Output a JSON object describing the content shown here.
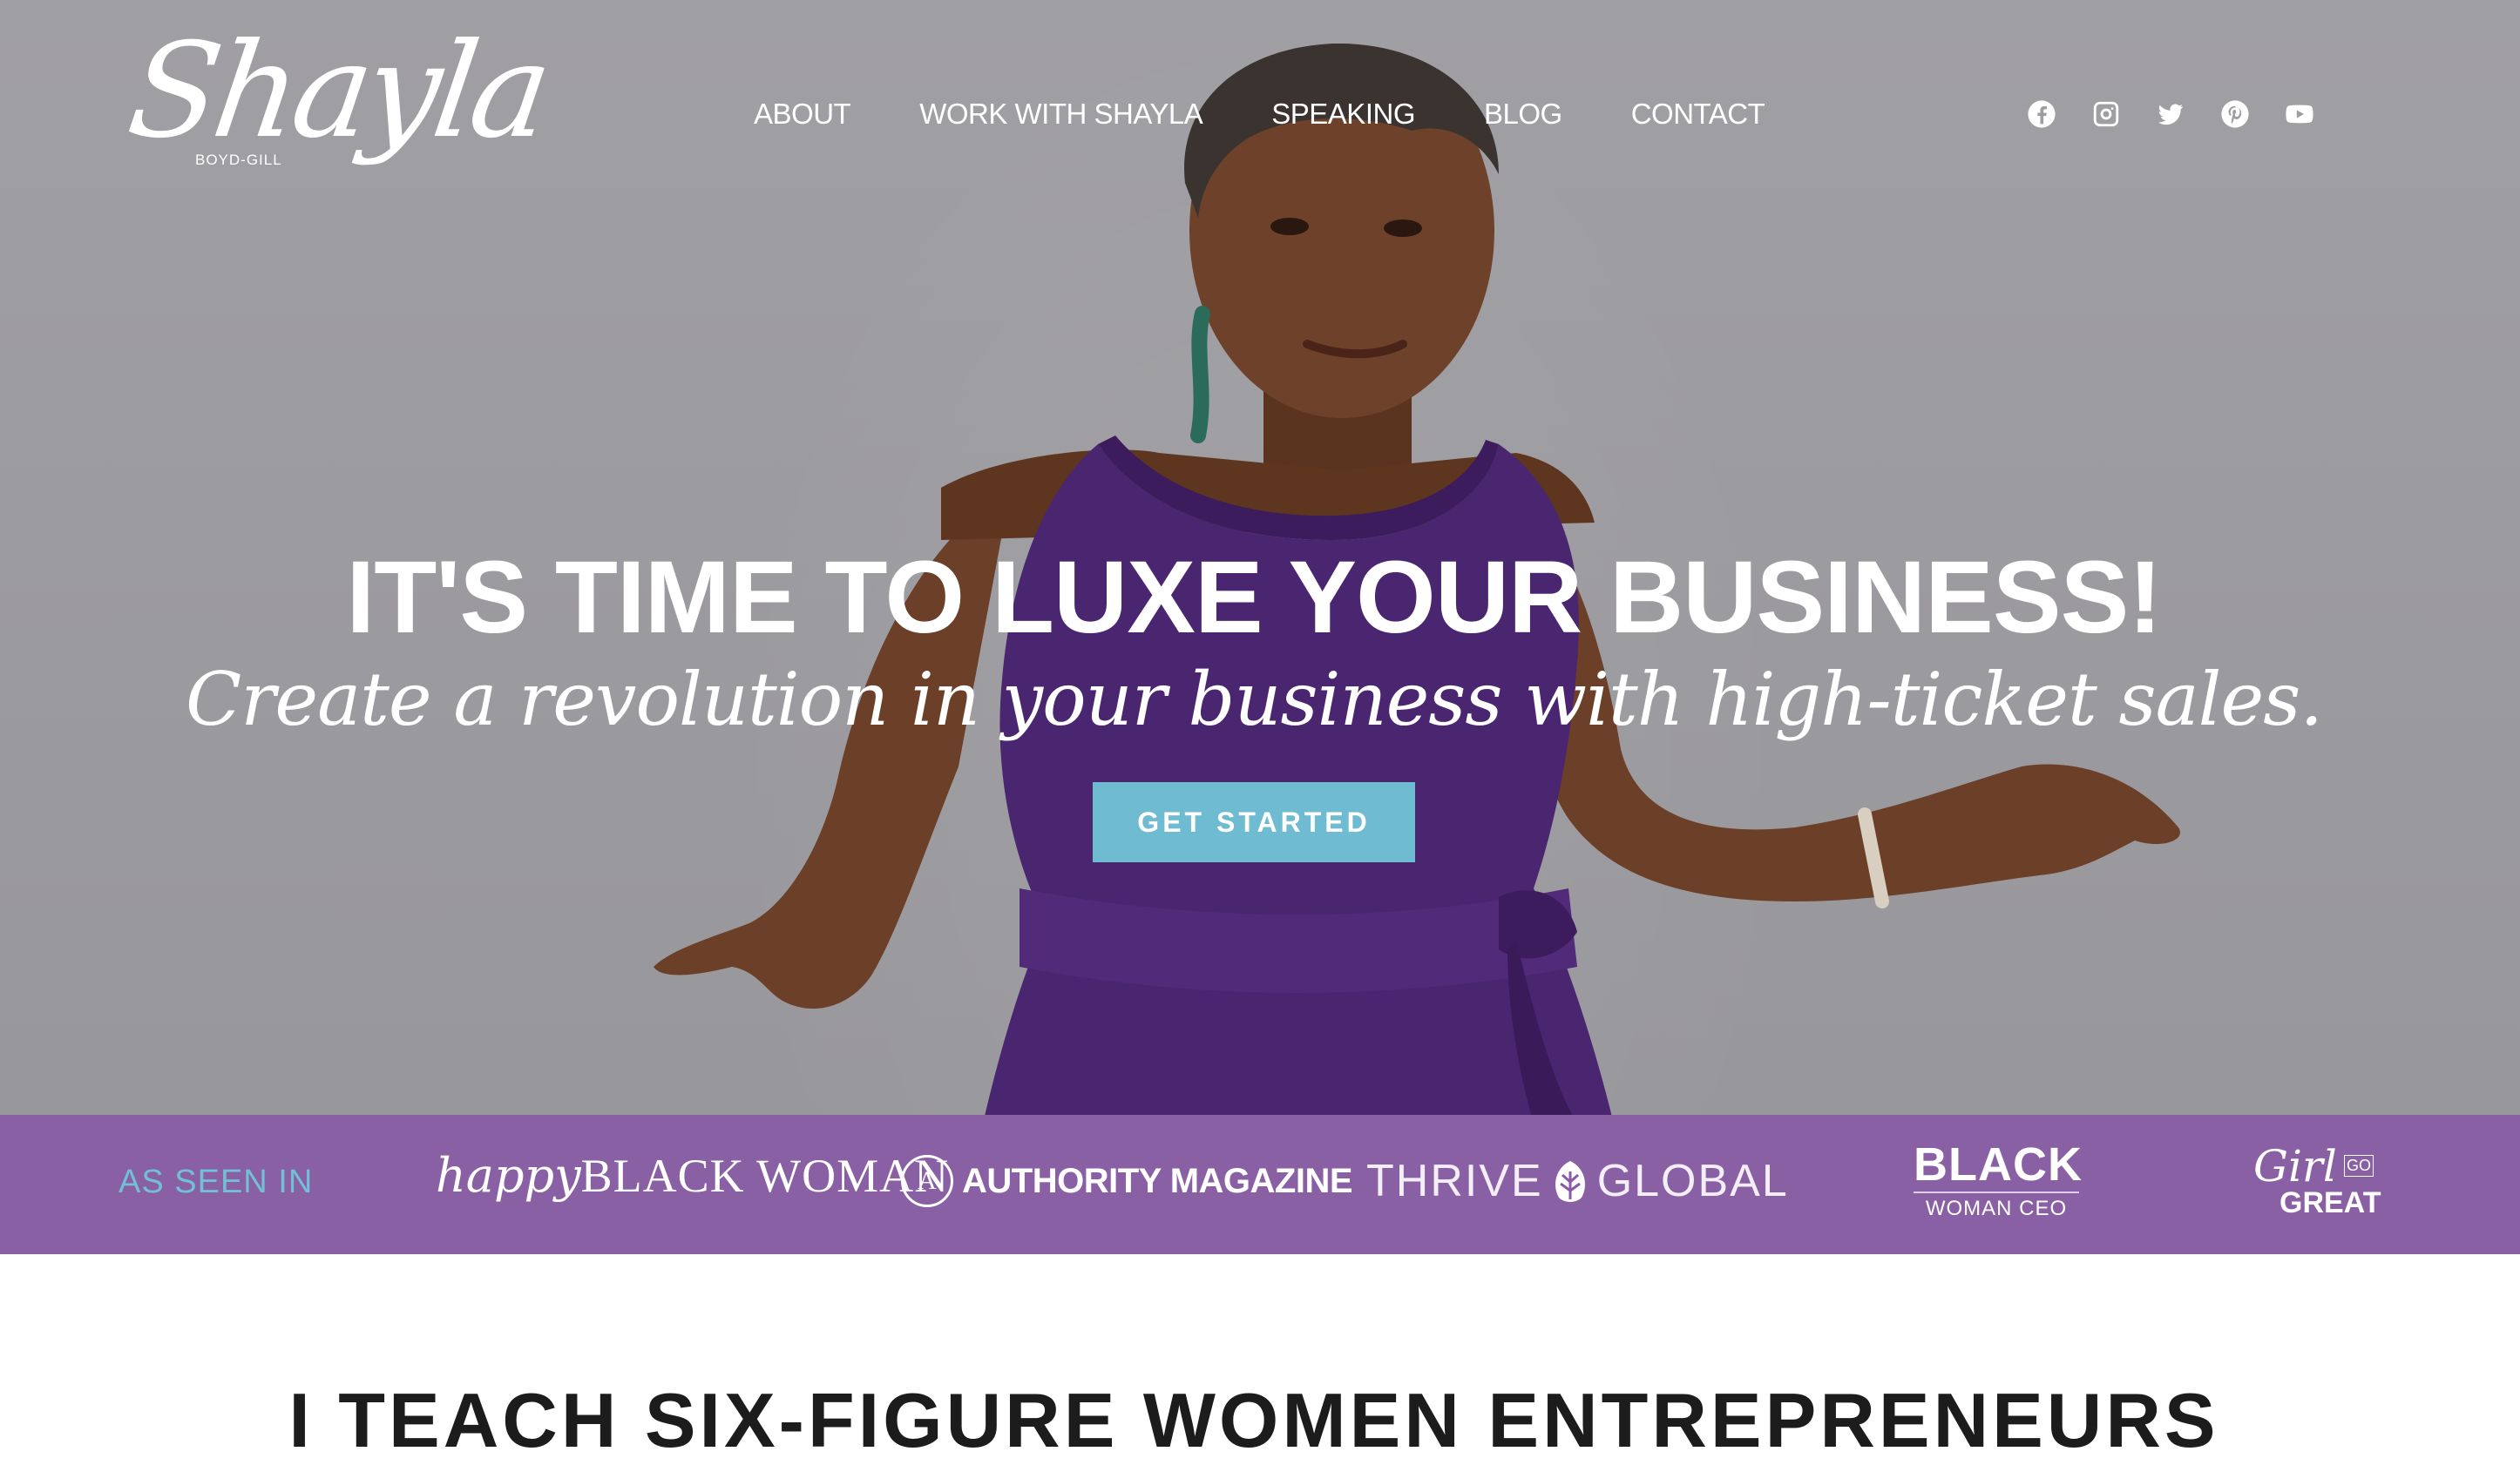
{
  "header": {
    "logo": {
      "script": "Shayla",
      "sub": "BOYD-GILL"
    },
    "nav": [
      "ABOUT",
      "WORK WITH SHAYLA",
      "SPEAKING",
      "BLOG",
      "CONTACT"
    ],
    "socials": [
      "facebook-icon",
      "instagram-icon",
      "twitter-icon",
      "pinterest-icon",
      "youtube-icon"
    ]
  },
  "hero": {
    "title": "IT'S TIME TO LUXE YOUR BUSINESS!",
    "subtitle": "Create a revolution in your business with high-ticket sales.",
    "cta_label": "GET STARTED"
  },
  "press": {
    "label": "AS SEEN IN",
    "logos": {
      "happy_black_woman": {
        "a": "happy",
        "b": "BLACK WOMAN"
      },
      "authority": {
        "mark": "A",
        "text": "AUTHORITY MAGAZINE"
      },
      "thrive": {
        "a": "THRIVE",
        "b": "GLOBAL"
      },
      "bwceo": {
        "big": "BLACK",
        "small": "WOMAN CEO"
      },
      "girl": {
        "script": "Girl",
        "big": "GREAT",
        "small": "GO"
      }
    }
  },
  "next_section": {
    "heading": "I TEACH SIX-FIGURE WOMEN ENTREPRENEURS"
  },
  "colors": {
    "hero_bg": "#9e9da1",
    "accent_blue": "#6fbcd2",
    "press_band": "#7a4a98",
    "dress": "#4a2570"
  }
}
